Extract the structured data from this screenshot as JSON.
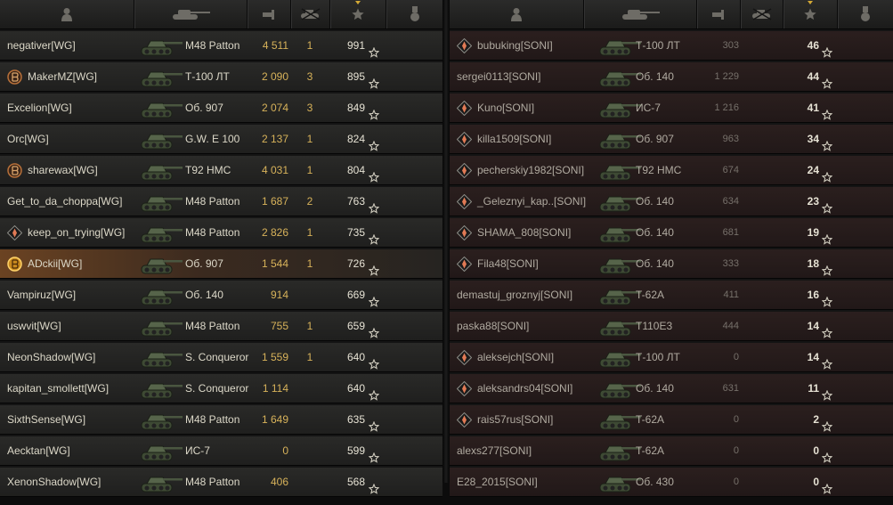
{
  "colors": {
    "accent": "#d7b25a",
    "sort": "#d4a935"
  },
  "header_icons": [
    "player-icon",
    "tank-icon",
    "damage-icon",
    "kills-icon",
    "experience-star-icon",
    "medal-icon"
  ],
  "left_team": [
    {
      "player": "negativer[WG]",
      "badge": null,
      "tank": "M48 Patton",
      "damage": "4 511",
      "kills": "1",
      "xp": "991"
    },
    {
      "player": "MakerMZ[WG]",
      "badge": "class-2-badge-icon",
      "tank": "Т-100 ЛТ",
      "damage": "2 090",
      "kills": "3",
      "xp": "895"
    },
    {
      "player": "Excelion[WG]",
      "badge": null,
      "tank": "Об. 907",
      "damage": "2 074",
      "kills": "3",
      "xp": "849"
    },
    {
      "player": "Orc[WG]",
      "badge": null,
      "tank": "G.W. E 100",
      "damage": "2 137",
      "kills": "1",
      "xp": "824"
    },
    {
      "player": "sharewax[WG]",
      "badge": "class-3-badge-icon",
      "tank": "T92 HMC",
      "damage": "4 031",
      "kills": "1",
      "xp": "804"
    },
    {
      "player": "Get_to_da_choppa[WG]",
      "badge": null,
      "tank": "M48 Patton",
      "damage": "1 687",
      "kills": "2",
      "xp": "763"
    },
    {
      "player": "keep_on_trying[WG]",
      "badge": "squad-icon",
      "tank": "M48 Patton",
      "damage": "2 826",
      "kills": "1",
      "xp": "735"
    },
    {
      "player": "ADckii[WG]",
      "badge": "top-gun-badge-icon",
      "tank": "Об. 907",
      "damage": "1 544",
      "kills": "1",
      "xp": "726",
      "highlight": true
    },
    {
      "player": "Vampiruz[WG]",
      "badge": null,
      "tank": "Об. 140",
      "damage": "914",
      "kills": "",
      "xp": "669"
    },
    {
      "player": "uswvit[WG]",
      "badge": null,
      "tank": "M48 Patton",
      "damage": "755",
      "kills": "1",
      "xp": "659"
    },
    {
      "player": "NeonShadow[WG]",
      "badge": null,
      "tank": "S. Conqueror",
      "damage": "1 559",
      "kills": "1",
      "xp": "640"
    },
    {
      "player": "kapitan_smollett[WG]",
      "badge": null,
      "tank": "S. Conqueror",
      "damage": "1 114",
      "kills": "",
      "xp": "640"
    },
    {
      "player": "SixthSense[WG]",
      "badge": null,
      "tank": "M48 Patton",
      "damage": "1 649",
      "kills": "",
      "xp": "635"
    },
    {
      "player": "Aecktan[WG]",
      "badge": null,
      "tank": "ИС-7",
      "damage": "0",
      "kills": "",
      "xp": "599"
    },
    {
      "player": "XenonShadow[WG]",
      "badge": null,
      "tank": "M48 Patton",
      "damage": "406",
      "kills": "",
      "xp": "568"
    }
  ],
  "right_team": [
    {
      "player": "bubuking[SONI]",
      "badge": "squad-icon",
      "tank": "Т-100 ЛТ",
      "damage": "303",
      "kills": "",
      "xp": "46"
    },
    {
      "player": "sergei0113[SONI]",
      "badge": null,
      "tank": "Об. 140",
      "damage": "1 229",
      "kills": "",
      "xp": "44"
    },
    {
      "player": "Kuno[SONI]",
      "badge": "squad-icon",
      "tank": "ИС-7",
      "damage": "1 216",
      "kills": "",
      "xp": "41"
    },
    {
      "player": "killa1509[SONI]",
      "badge": "squad-icon",
      "tank": "Об. 907",
      "damage": "963",
      "kills": "",
      "xp": "34"
    },
    {
      "player": "pecherskiy1982[SONI]",
      "badge": "squad-icon",
      "tank": "T92 HMC",
      "damage": "674",
      "kills": "",
      "xp": "24"
    },
    {
      "player": "_Geleznyi_kap..[SONI]",
      "badge": "squad-icon",
      "tank": "Об. 140",
      "damage": "634",
      "kills": "",
      "xp": "23"
    },
    {
      "player": "SHAMA_808[SONI]",
      "badge": "squad-icon",
      "tank": "Об. 140",
      "damage": "681",
      "kills": "",
      "xp": "19"
    },
    {
      "player": "Fila48[SONI]",
      "badge": "squad-icon",
      "tank": "Об. 140",
      "damage": "333",
      "kills": "",
      "xp": "18"
    },
    {
      "player": "demastuj_groznyj[SONI]",
      "badge": null,
      "tank": "T-62A",
      "damage": "411",
      "kills": "",
      "xp": "16"
    },
    {
      "player": "paska88[SONI]",
      "badge": null,
      "tank": "T110E3",
      "damage": "444",
      "kills": "",
      "xp": "14"
    },
    {
      "player": "aleksejch[SONI]",
      "badge": "squad-icon",
      "tank": "Т-100 ЛТ",
      "damage": "0",
      "kills": "",
      "xp": "14"
    },
    {
      "player": "aleksandrs04[SONI]",
      "badge": "squad-icon",
      "tank": "Об. 140",
      "damage": "631",
      "kills": "",
      "xp": "11"
    },
    {
      "player": "rais57rus[SONI]",
      "badge": "squad-icon",
      "tank": "T-62A",
      "damage": "0",
      "kills": "",
      "xp": "2"
    },
    {
      "player": "alexs277[SONI]",
      "badge": null,
      "tank": "T-62A",
      "damage": "0",
      "kills": "",
      "xp": "0"
    },
    {
      "player": "E28_2015[SONI]",
      "badge": null,
      "tank": "Об. 430",
      "damage": "0",
      "kills": "",
      "xp": "0"
    }
  ]
}
